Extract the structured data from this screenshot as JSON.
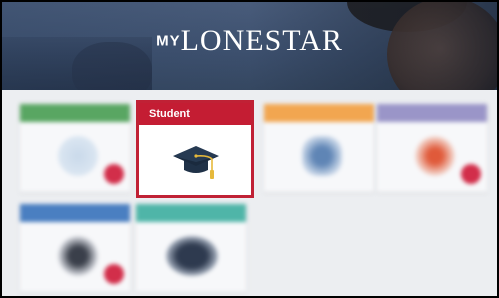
{
  "header": {
    "logo_prefix": "MY",
    "logo_name": "LONESTAR"
  },
  "tiles": [
    {
      "label": "",
      "bar_color": "#59a662",
      "icon": "blurred-icon"
    },
    {
      "label": "Student",
      "bar_color": "#c41d33",
      "icon": "graduation-cap-icon",
      "selected": true
    },
    {
      "label": "",
      "bar_color": "#f2a650",
      "icon": "blurred-icon"
    },
    {
      "label": "",
      "bar_color": "#9a95c8",
      "icon": "blurred-icon"
    },
    {
      "label": "",
      "bar_color": "#4a7fc1",
      "icon": "blurred-icon"
    },
    {
      "label": "",
      "bar_color": "#4fb5a8",
      "icon": "blurred-icon"
    }
  ],
  "colors": {
    "accent_red": "#c41d33",
    "tassel_gold": "#e6b93b",
    "cap_navy": "#263a52"
  }
}
